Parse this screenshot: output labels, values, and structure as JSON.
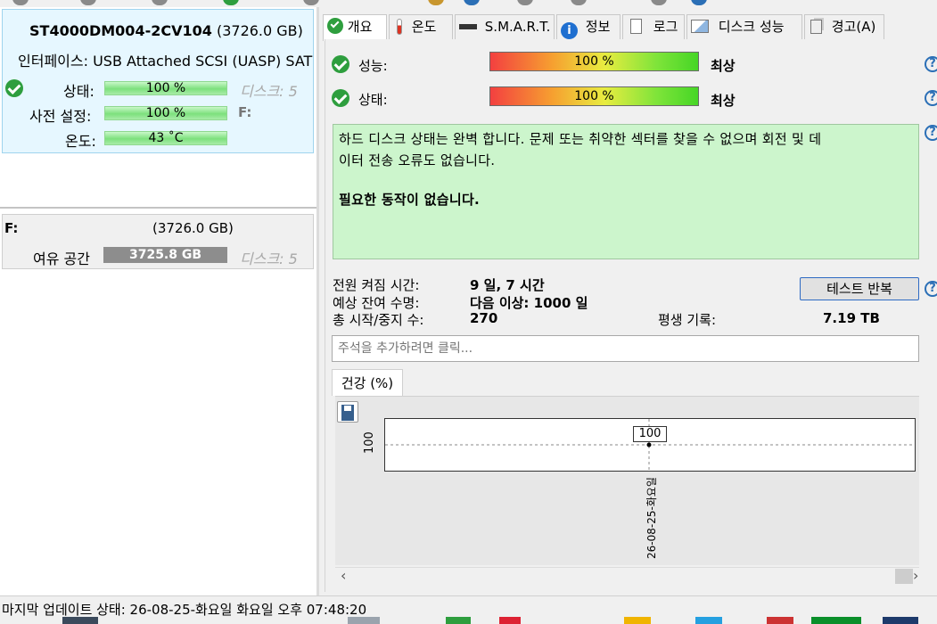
{
  "left": {
    "disk": {
      "model": "ST4000DM004-2CV104",
      "capacity": "(3726.0 GB)",
      "interface_label": "인터페이스:",
      "interface_value": "USB Attached SCSI (UASP) SAT",
      "status_label": "상태:",
      "status_value": "100 %",
      "status_pct": 100,
      "status_extra": "디스크: 5",
      "preset_label": "사전 설정:",
      "preset_value": "100 %",
      "preset_extra": "F:",
      "temp_label": "온도:",
      "temp_value": "43 ˚C"
    },
    "volume": {
      "drive": "F:",
      "capacity": "(3726.0 GB)",
      "free_label": "여유 공간",
      "free_value": "3725.8 GB",
      "disk_ref": "디스크: 5"
    }
  },
  "tabs": [
    {
      "label": "개요",
      "icon": "check-icon"
    },
    {
      "label": "온도",
      "icon": "thermometer-icon"
    },
    {
      "label": "S.M.A.R.T.",
      "icon": "drive-icon"
    },
    {
      "label": "정보",
      "icon": "info-icon"
    },
    {
      "label": "로그",
      "icon": "document-icon"
    },
    {
      "label": "디스크 성능",
      "icon": "chart-icon"
    },
    {
      "label": "경고(A)",
      "icon": "copy-icon"
    }
  ],
  "overview": {
    "perf_label": "성능:",
    "perf_value": "100 %",
    "perf_rating": "최상",
    "health_label": "상태:",
    "health_value": "100 %",
    "health_rating": "최상",
    "message_line1": "하드 디스크 상태는 완벽 합니다. 문제 또는 취약한 섹터를 찾을 수 없으며 회전 및 데",
    "message_line2": "이터 전송 오류도 없습니다.",
    "message_action": "필요한 동작이 없습니다.",
    "power_on_label": "전원 켜짐 시간:",
    "power_on_value": "9 일, 7 시간",
    "life_label": "예상 잔여 수명:",
    "life_value": "다음 이상: 1000 일",
    "starts_label": "총 시작/중지 수:",
    "starts_value": "270",
    "lifetime_label": "평생 기록:",
    "lifetime_value": "7.19 TB",
    "test_button": "테스트 반복",
    "note_placeholder": "주석을 추가하려면 클릭...",
    "help_glyph": "?"
  },
  "chart_tab": "건강 (%)",
  "chart_data": {
    "type": "line",
    "x": [
      "26-08-25-화요일"
    ],
    "values": [
      100
    ],
    "ytick": "100",
    "point_label": "100"
  },
  "scroll": {
    "left_arrow": "‹",
    "right_arrow": "›"
  },
  "statusbar": {
    "text": "마지막 업데이트 상태: 26-08-25-화요일 화요일 오후 07:48:20"
  },
  "colors": {
    "accent": "#2e6ac3",
    "ok": "#2e9e3e",
    "status_bg": "#ccf5cc",
    "card_bg": "#e6f7ff"
  }
}
